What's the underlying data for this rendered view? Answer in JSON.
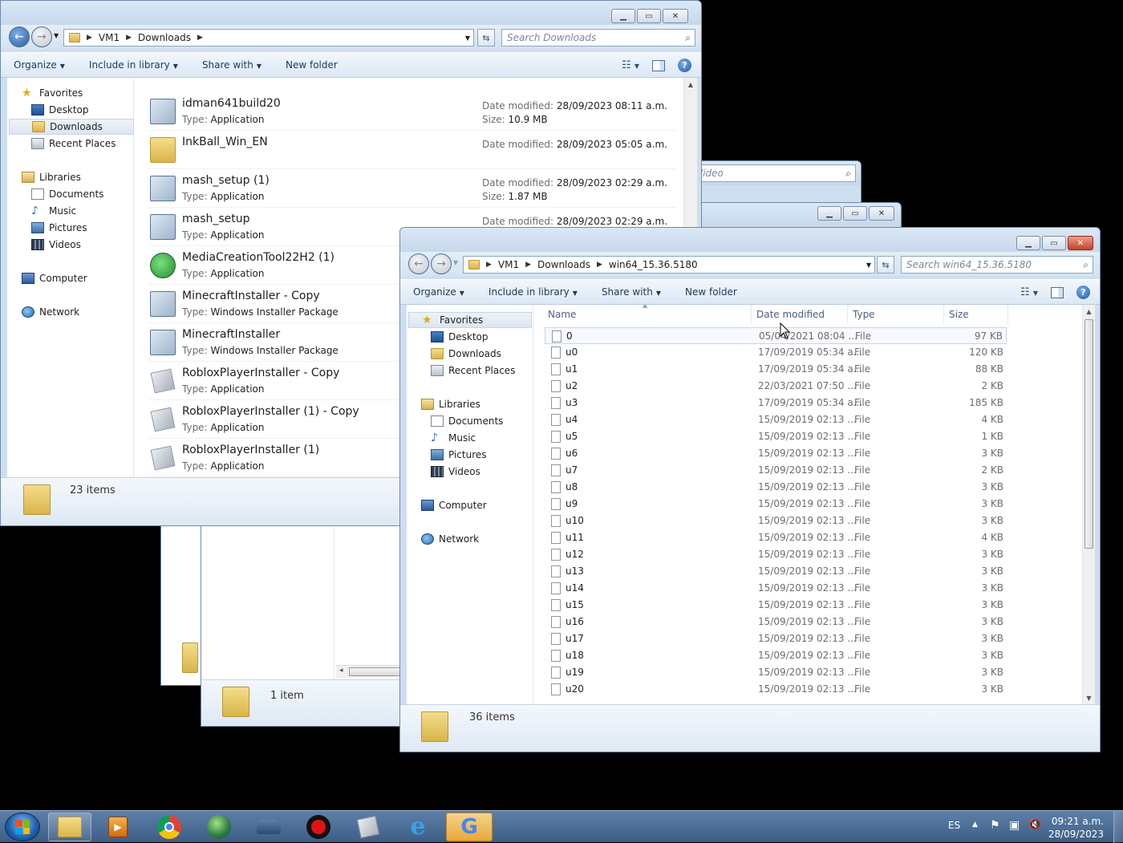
{
  "win1": {
    "breadcrumb": [
      "VM1",
      "Downloads"
    ],
    "search_placeholder": "Search Downloads",
    "toolbar": {
      "organize": "Organize",
      "include": "Include in library",
      "share": "Share with",
      "new_folder": "New folder"
    },
    "nav": {
      "favorites": "Favorites",
      "desktop": "Desktop",
      "downloads": "Downloads",
      "recent": "Recent Places",
      "libraries": "Libraries",
      "documents": "Documents",
      "music": "Music",
      "pictures": "Pictures",
      "videos": "Videos",
      "computer": "Computer",
      "network": "Network"
    },
    "files": [
      {
        "name": "idman641build20",
        "type": "Application",
        "date": "28/09/2023 08:11 a.m.",
        "size": "10.9 MB",
        "icon": "app-icon"
      },
      {
        "name": "InkBall_Win_EN",
        "type": "",
        "date": "28/09/2023 05:05 a.m.",
        "size": "",
        "icon": "folder-icon"
      },
      {
        "name": "mash_setup (1)",
        "type": "Application",
        "date": "28/09/2023 02:29 a.m.",
        "size": "1.87 MB",
        "icon": "app-icon"
      },
      {
        "name": "mash_setup",
        "type": "Application",
        "date": "28/09/2023 02:29 a.m.",
        "size": "",
        "icon": "app-icon"
      },
      {
        "name": "MediaCreationTool22H2 (1)",
        "type": "Application",
        "date": "",
        "size": "",
        "icon": "mct-icon"
      },
      {
        "name": "MinecraftInstaller - Copy",
        "type": "Windows Installer Package",
        "date": "",
        "size": "",
        "icon": "msi-icon"
      },
      {
        "name": "MinecraftInstaller",
        "type": "Windows Installer Package",
        "date": "",
        "size": "",
        "icon": "msi-icon"
      },
      {
        "name": "RobloxPlayerInstaller - Copy",
        "type": "Application",
        "date": "",
        "size": "",
        "icon": "roblox-icon"
      },
      {
        "name": "RobloxPlayerInstaller (1) - Copy",
        "type": "Application",
        "date": "",
        "size": "",
        "icon": "roblox-icon"
      },
      {
        "name": "RobloxPlayerInstaller (1)",
        "type": "Application",
        "date": "",
        "size": "",
        "icon": "roblox-icon"
      }
    ],
    "labels": {
      "type": "Type:",
      "date": "Date modified:",
      "size": "Size:"
    },
    "status": "23 items"
  },
  "win2": {
    "search_fragment": "Video"
  },
  "win3": {
    "status": "1 item"
  },
  "win4": {
    "breadcrumb": [
      "VM1",
      "Downloads",
      "win64_15.36.5180"
    ],
    "search_placeholder": "Search win64_15.36.5180",
    "toolbar": {
      "organize": "Organize",
      "include": "Include in library",
      "share": "Share with",
      "new_folder": "New folder"
    },
    "nav": {
      "favorites": "Favorites",
      "desktop": "Desktop",
      "downloads": "Downloads",
      "recent": "Recent Places",
      "libraries": "Libraries",
      "documents": "Documents",
      "music": "Music",
      "pictures": "Pictures",
      "videos": "Videos",
      "computer": "Computer",
      "network": "Network"
    },
    "columns": {
      "name": "Name",
      "date": "Date modified",
      "type": "Type",
      "size": "Size"
    },
    "rows": [
      {
        "name": "0",
        "date": "05/04/2021 08:04 ...",
        "type": "File",
        "size": "97 KB"
      },
      {
        "name": "u0",
        "date": "17/09/2019 05:34 a...",
        "type": "File",
        "size": "120 KB"
      },
      {
        "name": "u1",
        "date": "17/09/2019 05:34 a...",
        "type": "File",
        "size": "88 KB"
      },
      {
        "name": "u2",
        "date": "22/03/2021 07:50 ...",
        "type": "File",
        "size": "2 KB"
      },
      {
        "name": "u3",
        "date": "17/09/2019 05:34 a...",
        "type": "File",
        "size": "185 KB"
      },
      {
        "name": "u4",
        "date": "15/09/2019 02:13 ...",
        "type": "File",
        "size": "4 KB"
      },
      {
        "name": "u5",
        "date": "15/09/2019 02:13 ...",
        "type": "File",
        "size": "1 KB"
      },
      {
        "name": "u6",
        "date": "15/09/2019 02:13 ...",
        "type": "File",
        "size": "3 KB"
      },
      {
        "name": "u7",
        "date": "15/09/2019 02:13 ...",
        "type": "File",
        "size": "2 KB"
      },
      {
        "name": "u8",
        "date": "15/09/2019 02:13 ...",
        "type": "File",
        "size": "3 KB"
      },
      {
        "name": "u9",
        "date": "15/09/2019 02:13 ...",
        "type": "File",
        "size": "3 KB"
      },
      {
        "name": "u10",
        "date": "15/09/2019 02:13 ...",
        "type": "File",
        "size": "3 KB"
      },
      {
        "name": "u11",
        "date": "15/09/2019 02:13 ...",
        "type": "File",
        "size": "4 KB"
      },
      {
        "name": "u12",
        "date": "15/09/2019 02:13 ...",
        "type": "File",
        "size": "3 KB"
      },
      {
        "name": "u13",
        "date": "15/09/2019 02:13 ...",
        "type": "File",
        "size": "3 KB"
      },
      {
        "name": "u14",
        "date": "15/09/2019 02:13 ...",
        "type": "File",
        "size": "3 KB"
      },
      {
        "name": "u15",
        "date": "15/09/2019 02:13 ...",
        "type": "File",
        "size": "3 KB"
      },
      {
        "name": "u16",
        "date": "15/09/2019 02:13 ...",
        "type": "File",
        "size": "3 KB"
      },
      {
        "name": "u17",
        "date": "15/09/2019 02:13 ...",
        "type": "File",
        "size": "3 KB"
      },
      {
        "name": "u18",
        "date": "15/09/2019 02:13 ...",
        "type": "File",
        "size": "3 KB"
      },
      {
        "name": "u19",
        "date": "15/09/2019 02:13 ...",
        "type": "File",
        "size": "3 KB"
      },
      {
        "name": "u20",
        "date": "15/09/2019 02:13 ...",
        "type": "File",
        "size": "3 KB"
      }
    ],
    "status": "36 items"
  },
  "taskbar": {
    "apps": [
      "explorer-icon",
      "media-player-icon",
      "chrome-icon",
      "network-globe-icon",
      "tank-game-icon",
      "record-icon",
      "roblox-icon",
      "ie-icon",
      "google-icon"
    ],
    "lang": "ES",
    "time": "09:21 a.m.",
    "date": "28/09/2023"
  }
}
